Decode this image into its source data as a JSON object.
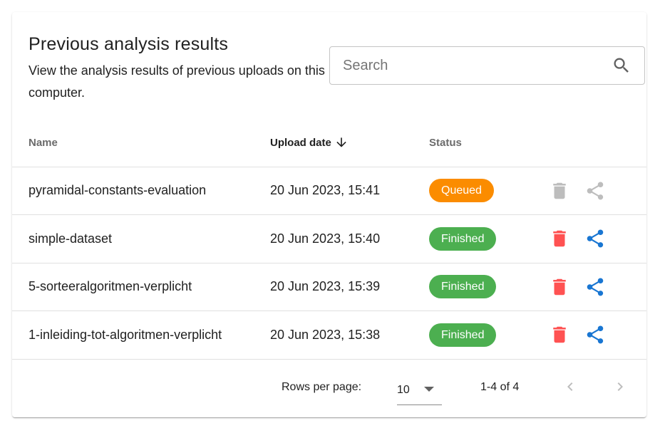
{
  "header": {
    "title": "Previous analysis results",
    "subtitle": "View the analysis results of previous uploads on this computer."
  },
  "search": {
    "placeholder": "Search",
    "value": "",
    "icon": "search-icon"
  },
  "table": {
    "columns": [
      {
        "label": "Name",
        "sortable": false
      },
      {
        "label": "Upload date",
        "sortable": true,
        "sort_direction": "descending",
        "sort_icon": "arrow-down-icon"
      },
      {
        "label": "Status",
        "sortable": false
      }
    ],
    "rows": [
      {
        "name": "pyramidal-constants-evaluation",
        "upload_date": "20 Jun 2023, 15:41",
        "status": "Queued",
        "status_color": "#fb8c00",
        "actions_enabled": false
      },
      {
        "name": "simple-dataset",
        "upload_date": "20 Jun 2023, 15:40",
        "status": "Finished",
        "status_color": "#4caf50",
        "actions_enabled": true
      },
      {
        "name": "5-sorteeralgoritmen-verplicht",
        "upload_date": "20 Jun 2023, 15:39",
        "status": "Finished",
        "status_color": "#4caf50",
        "actions_enabled": true
      },
      {
        "name": "1-inleiding-tot-algoritmen-verplicht",
        "upload_date": "20 Jun 2023, 15:38",
        "status": "Finished",
        "status_color": "#4caf50",
        "actions_enabled": true
      }
    ],
    "row_actions": {
      "delete_icon": "trash-icon",
      "share_icon": "share-icon"
    }
  },
  "pagination": {
    "rows_per_page_label": "Rows per page:",
    "rows_per_page_value": "10",
    "range_text": "1-4 of 4",
    "prev_icon": "chevron-left-icon",
    "next_icon": "chevron-right-icon",
    "prev_enabled": false,
    "next_enabled": false
  },
  "colors": {
    "delete_active": "#ff5252",
    "share_active": "#1976d2",
    "action_disabled": "#bdbdbd",
    "queued": "#fb8c00",
    "finished": "#4caf50"
  }
}
